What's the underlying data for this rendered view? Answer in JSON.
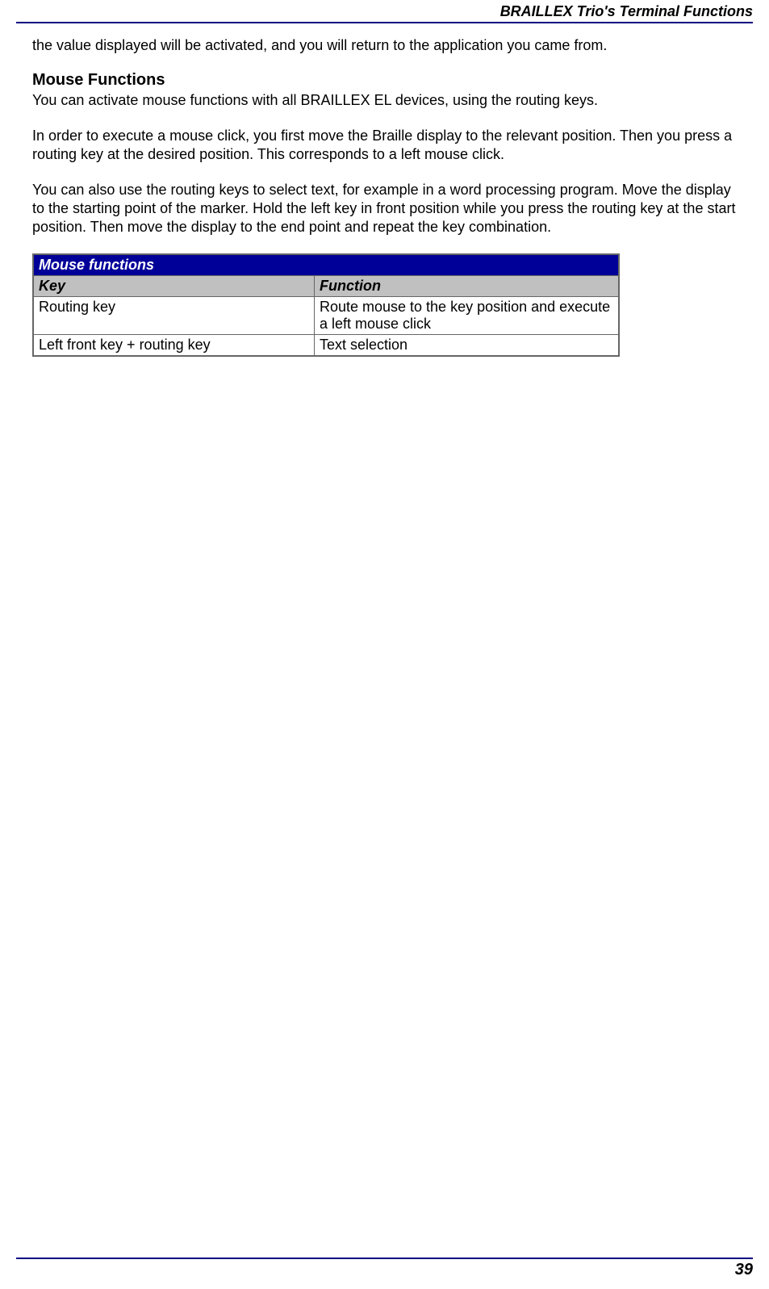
{
  "header": {
    "title": "BRAILLEX Trio's Terminal Functions"
  },
  "body": {
    "intro": "the value displayed will be activated, and you will return to the application you came from.",
    "section_heading": "Mouse Functions",
    "p1": "You can activate mouse functions with all BRAILLEX EL devices, using the routing keys.",
    "p2": "In order to execute a mouse click, you first move the Braille display to the relevant position. Then you press a routing key at the desired position. This corresponds to a left mouse click.",
    "p3": "You can also use the routing keys to select text, for example in a word processing program. Move the display to the starting point of the marker. Hold the left key in front position while you press the routing key at the start position. Then move the display to the end point and repeat the key combination."
  },
  "table": {
    "title": "Mouse functions",
    "columns": {
      "c1": "Key",
      "c2": "Function"
    },
    "rows": [
      {
        "key": "Routing key",
        "func": "Route mouse to the key position and execute a left mouse click"
      },
      {
        "key": "Left front key + routing key",
        "func": "Text selection"
      }
    ]
  },
  "footer": {
    "page_number": "39"
  }
}
